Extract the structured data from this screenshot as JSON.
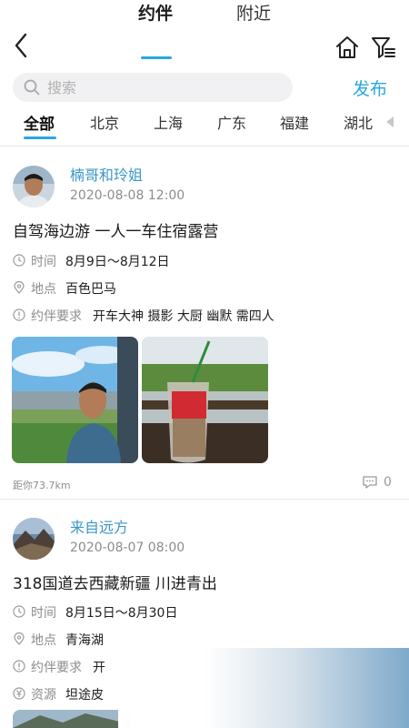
{
  "header": {
    "tabs": [
      {
        "label": "约伴",
        "active": true
      },
      {
        "label": "附近",
        "active": false
      }
    ],
    "icons": [
      "back-icon",
      "home-icon",
      "filter-icon"
    ]
  },
  "search": {
    "placeholder": "搜索",
    "publish_label": "发布"
  },
  "regions": [
    "全部",
    "北京",
    "上海",
    "广东",
    "福建",
    "湖北"
  ],
  "posts": [
    {
      "author": "楠哥和玲姐",
      "time": "2020-08-08 12:00",
      "title": "自驾海边游 一人一车住宿露营",
      "fields": [
        {
          "icon": "clock-icon",
          "label": "时间",
          "value": "8月9日～8月12日"
        },
        {
          "icon": "location-icon",
          "label": "地点",
          "value": "百色巴马"
        },
        {
          "icon": "info-icon",
          "label": "约伴要求",
          "value": "开车大神 摄影 大厨 幽默 需四人"
        }
      ],
      "distance": "距你73.7km",
      "comments": "0"
    },
    {
      "author": "来自远方",
      "time": "2020-08-07 08:00",
      "title": "318国道去西藏新疆 川进青出",
      "fields": [
        {
          "icon": "clock-icon",
          "label": "时间",
          "value": "8月15日～8月30日"
        },
        {
          "icon": "location-icon",
          "label": "地点",
          "value": "青海湖"
        },
        {
          "icon": "info-icon",
          "label": "约伴要求",
          "value": "开"
        },
        {
          "icon": "yuan-icon",
          "label": "资源",
          "value": "坦途皮"
        }
      ]
    }
  ],
  "colors": {
    "accent": "#2aa6e0",
    "author": "#3a97c9",
    "muted": "#8c8c8c"
  }
}
